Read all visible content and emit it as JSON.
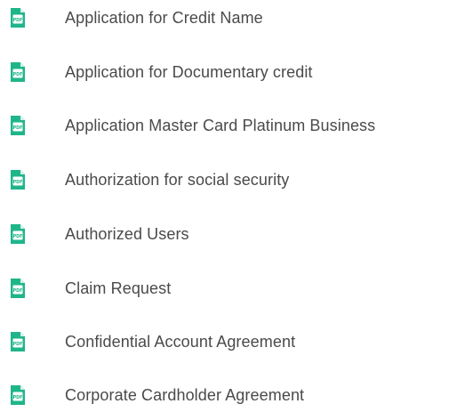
{
  "colors": {
    "icon_accent": "#1fb58a",
    "text": "#4a4a4a",
    "background": "#ffffff"
  },
  "documents": {
    "items": [
      {
        "label": "Application for Credit Name",
        "icon": "pdf-document-icon",
        "icon_text": "PDF"
      },
      {
        "label": "Application for Documentary credit",
        "icon": "pdf-document-icon",
        "icon_text": "PDF"
      },
      {
        "label": "Application Master Card Platinum Business",
        "icon": "pdf-document-icon",
        "icon_text": "PDF"
      },
      {
        "label": "Authorization for social security",
        "icon": "pdf-document-icon",
        "icon_text": "PDF"
      },
      {
        "label": "Authorized Users",
        "icon": "pdf-document-icon",
        "icon_text": "PDF"
      },
      {
        "label": "Claim Request",
        "icon": "pdf-document-icon",
        "icon_text": "PDF"
      },
      {
        "label": "Confidential Account Agreement",
        "icon": "pdf-document-icon",
        "icon_text": "PDF"
      },
      {
        "label": "Corporate Cardholder Agreement",
        "icon": "pdf-document-icon",
        "icon_text": "PDF"
      }
    ]
  }
}
